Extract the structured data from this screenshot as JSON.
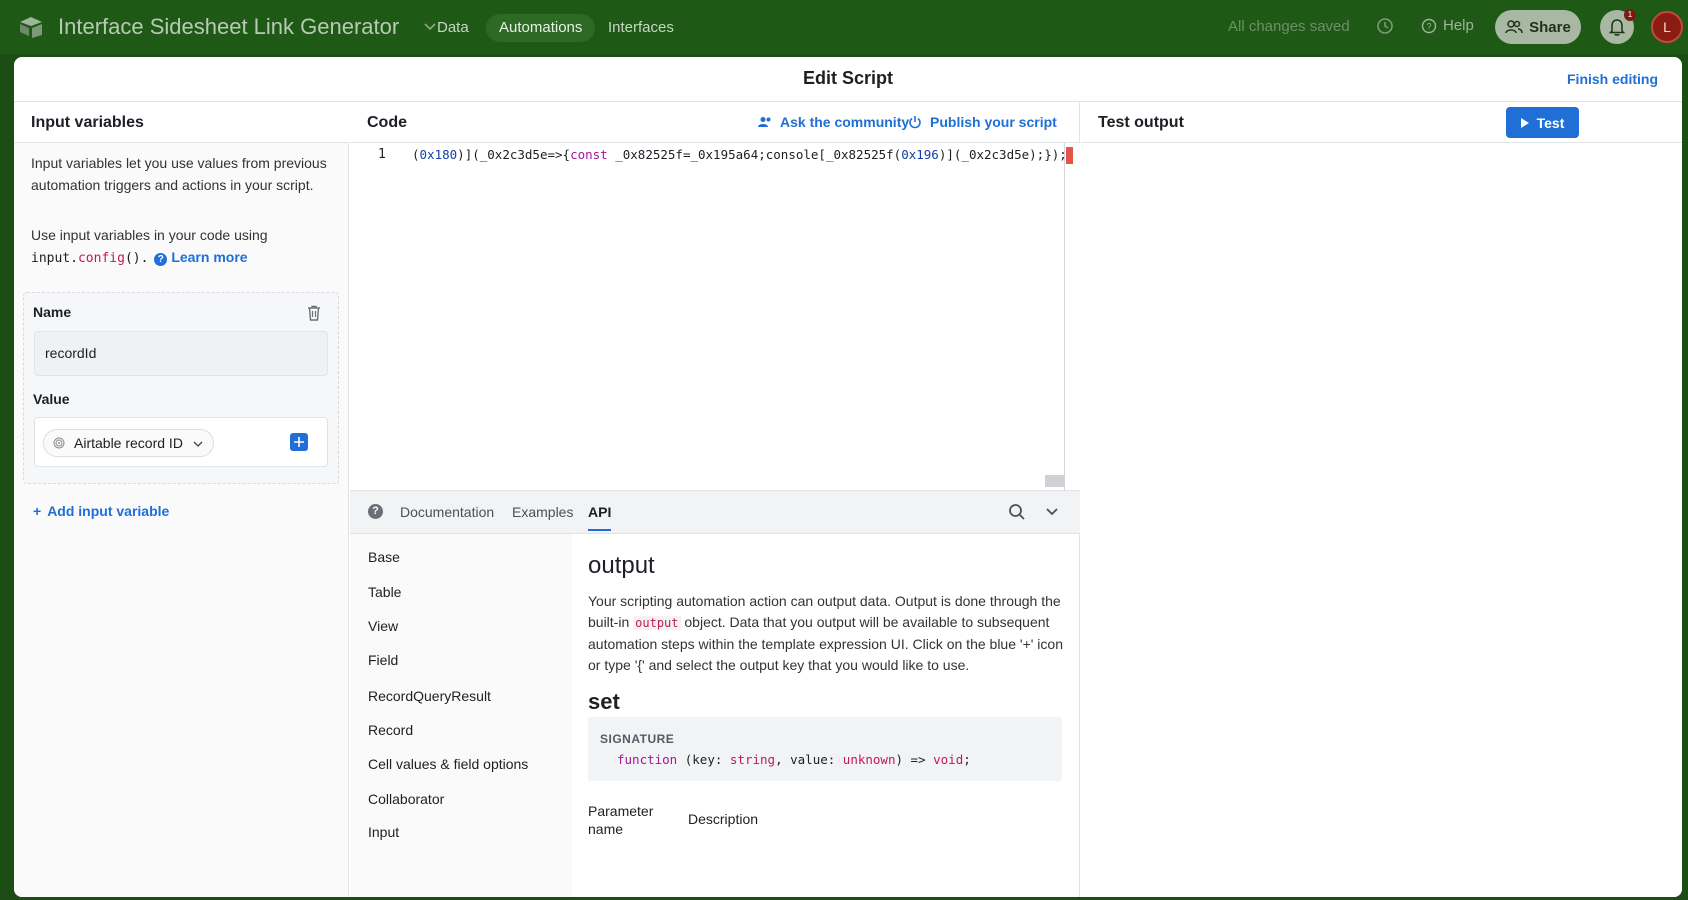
{
  "app": {
    "title": "Interface Sidesheet Link Generator",
    "nav": [
      "Data",
      "Automations",
      "Interfaces"
    ],
    "active_nav": "Automations",
    "saved_status": "All changes saved",
    "help_label": "Help",
    "share_label": "Share",
    "notification_count": "1",
    "avatar_initial": "L"
  },
  "dialog": {
    "title": "Edit Script",
    "finish_label": "Finish editing"
  },
  "input_panel": {
    "title": "Input variables",
    "intro": "Input variables let you use values from previous automation triggers and actions in your script.",
    "usage_prefix": "Use input variables in your code using",
    "usage_code_obj": "input",
    "usage_code_method": "config",
    "usage_code_suffix": "().",
    "learn_more": "Learn more",
    "name_label": "Name",
    "name_value": "recordId",
    "value_label": "Value",
    "value_selected": "Airtable record ID",
    "add_label": "Add input variable"
  },
  "code_panel": {
    "title": "Code",
    "community_label": "Ask the community",
    "publish_label": "Publish your script",
    "line_number": "1",
    "code_line_parts": {
      "p1": "(",
      "n1": "0x180",
      "p2": ")](_0x2c3d5e=>{",
      "kw": "const",
      "p3": " _0x82525f=_0x195a64;console[_0x82525f(",
      "n2": "0x196",
      "p4": ")](_0x2c3d5e);});"
    }
  },
  "docs": {
    "tabs": [
      "Documentation",
      "Examples",
      "API"
    ],
    "active_tab": "API",
    "nav_items": [
      "Base",
      "Table",
      "View",
      "Field",
      "RecordQueryResult",
      "Record",
      "Cell values & field options",
      "Collaborator",
      "Input"
    ],
    "heading": "output",
    "paragraph_a": "Your scripting automation action can output data. Output is done through the built-in",
    "paragraph_code": "output",
    "paragraph_b": "object. Data that you output will be available to subsequent automation steps within the template expression UI. Click on the blue '+' icon or type '{' and select the output key that you would like to use.",
    "subheading": "set",
    "signature_label": "SIGNATURE",
    "signature": {
      "fn": "function",
      "a": " (key: ",
      "t1": "string",
      "b": ", value: ",
      "t2": "unknown",
      "c": ") => ",
      "t3": "void",
      "d": ";"
    },
    "param_header": "Parameter name",
    "desc_header": "Description"
  },
  "test_panel": {
    "title": "Test output",
    "test_label": "Test"
  },
  "colors": {
    "accent": "#1f6fd6",
    "topbar": "#1e5a16",
    "error_marker": "#e1554a"
  }
}
